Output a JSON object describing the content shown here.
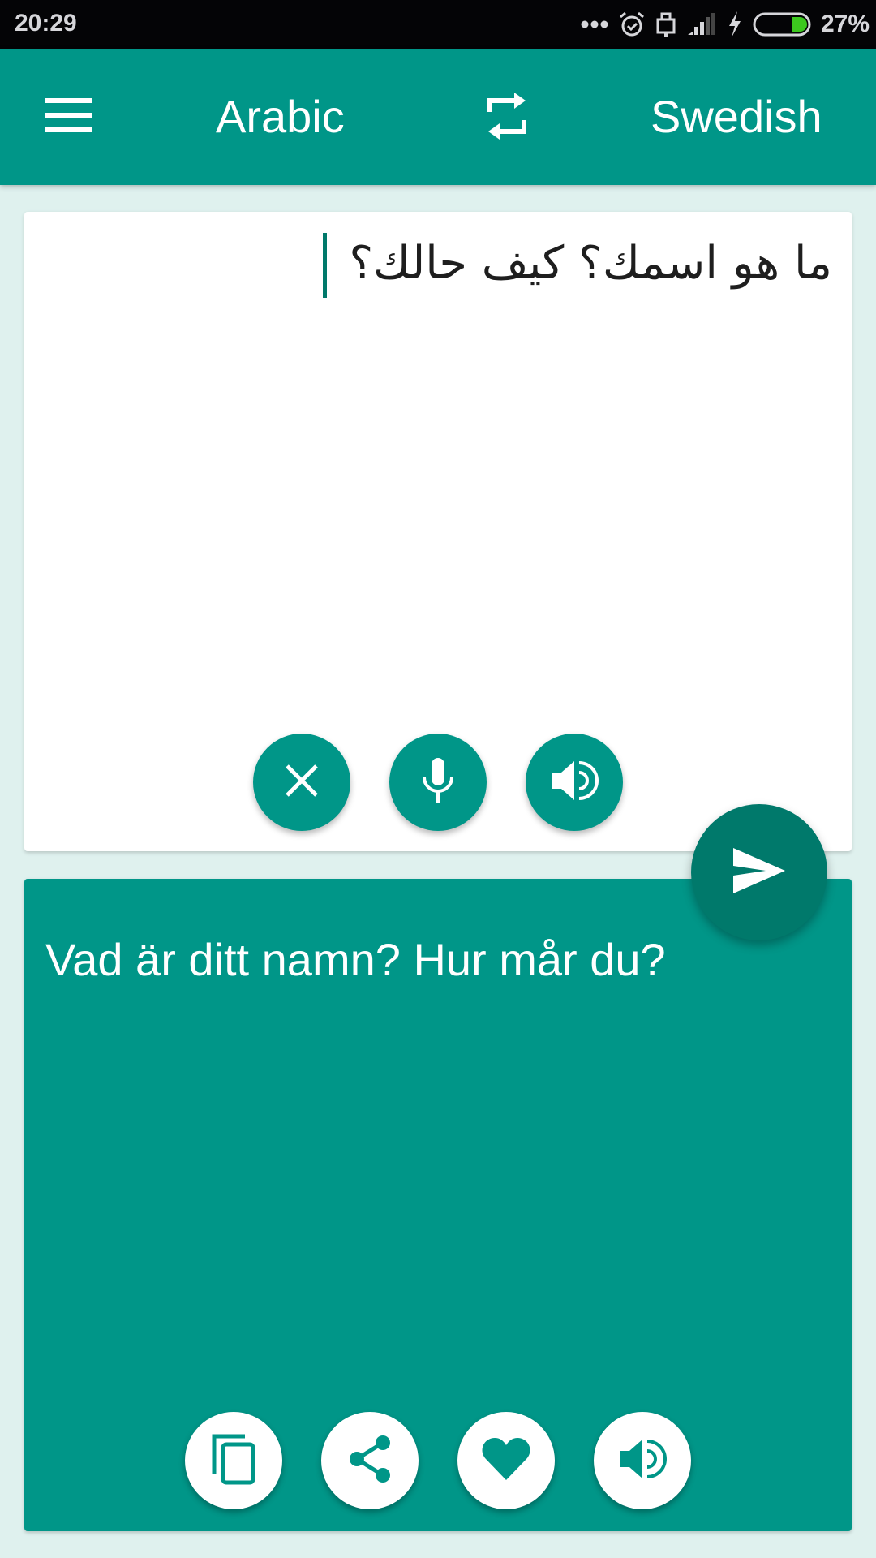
{
  "status_bar": {
    "time": "20:29",
    "battery_percent": "27%",
    "battery_level": 0.27,
    "icons": [
      "more-dots-icon",
      "alarm-icon",
      "usb-debug-icon",
      "signal-icon",
      "charging-bolt-icon",
      "battery-icon"
    ]
  },
  "toolbar": {
    "menu_icon": "hamburger-menu-icon",
    "source_language": "Arabic",
    "swap_icon": "swap-languages-icon",
    "target_language": "Swedish"
  },
  "input": {
    "text": "ما هو اسمك؟ كيف حالك؟",
    "direction": "rtl",
    "buttons": [
      {
        "name": "clear",
        "icon": "close-icon"
      },
      {
        "name": "voice-input",
        "icon": "microphone-icon"
      },
      {
        "name": "speak-source",
        "icon": "speaker-icon"
      }
    ]
  },
  "translate_button": {
    "icon": "send-icon"
  },
  "output": {
    "text": "Vad är ditt namn? Hur mår du?",
    "buttons": [
      {
        "name": "copy",
        "icon": "copy-icon"
      },
      {
        "name": "share",
        "icon": "share-icon"
      },
      {
        "name": "favorite",
        "icon": "heart-icon"
      },
      {
        "name": "speak-translation",
        "icon": "speaker-icon"
      }
    ]
  },
  "colors": {
    "primary": "#009688",
    "primary_dark": "#00796b",
    "background": "#dff1ee",
    "battery_fill": "#3cc81e"
  }
}
